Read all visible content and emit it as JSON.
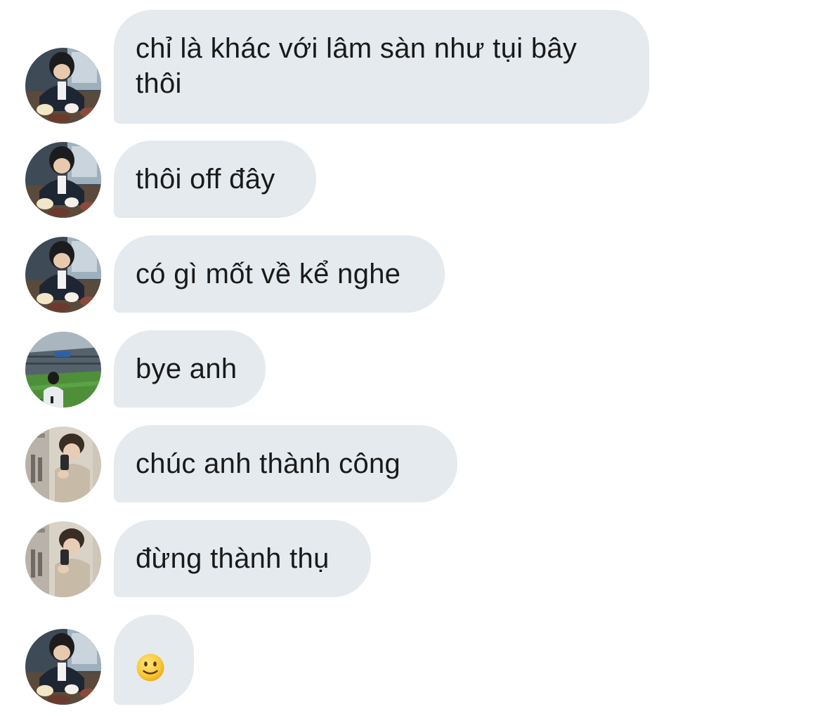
{
  "messages": [
    {
      "text": "chỉ là khác với lâm sàn như tụi bây thôi",
      "sender_avatar": "avatar-person-eating"
    },
    {
      "text": "thôi off đây",
      "sender_avatar": "avatar-person-eating"
    },
    {
      "text": "có gì mốt về kể nghe",
      "sender_avatar": "avatar-person-eating"
    },
    {
      "text": "bye anh",
      "sender_avatar": "avatar-stadium"
    },
    {
      "text": "chúc anh thành công",
      "sender_avatar": "avatar-mirror-selfie"
    },
    {
      "text": "đừng thành thụ",
      "sender_avatar": "avatar-mirror-selfie"
    },
    {
      "text": "🙂",
      "sender_avatar": "avatar-person-eating",
      "is_emoji": true,
      "icon": "slightly-smiling-face-icon"
    }
  ],
  "colors": {
    "bubble_bg": "#e5eaee",
    "text": "#1a1a1a",
    "background": "#ffffff"
  }
}
